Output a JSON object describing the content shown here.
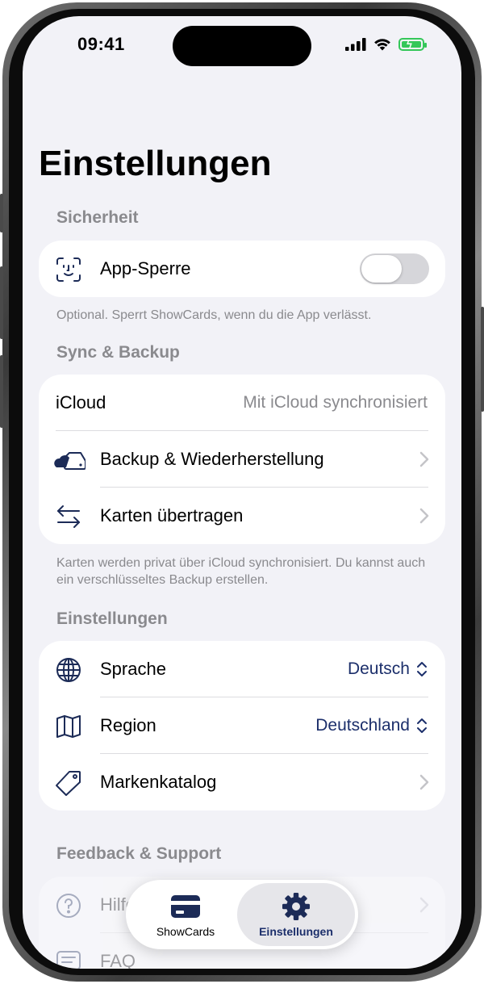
{
  "status_bar": {
    "time": "09:41"
  },
  "page": {
    "title": "Einstellungen"
  },
  "sections": {
    "security": {
      "header": "Sicherheit",
      "app_lock_label": "App-Sperre",
      "app_lock_on": false,
      "footer": "Optional. Sperrt ShowCards, wenn du die App verlässt."
    },
    "sync": {
      "header": "Sync & Backup",
      "icloud_label": "iCloud",
      "icloud_value": "Mit iCloud synchronisiert",
      "backup_label": "Backup & Wiederherstellung",
      "transfer_label": "Karten übertragen",
      "footer": "Karten werden privat über iCloud synchronisiert. Du kannst auch ein verschlüsseltes Backup erstellen."
    },
    "settings": {
      "header": "Einstellungen",
      "language_label": "Sprache",
      "language_value": "Deutsch",
      "region_label": "Region",
      "region_value": "Deutschland",
      "catalog_label": "Markenkatalog"
    },
    "support": {
      "header": "Feedback & Support",
      "help_label": "Hilfe",
      "faq_label": "FAQ"
    }
  },
  "tabbar": {
    "tabs": [
      {
        "label": "ShowCards",
        "icon": "card-icon",
        "selected": false
      },
      {
        "label": "Einstellungen",
        "icon": "gear-icon",
        "selected": true
      }
    ]
  },
  "colors": {
    "accent": "#1c2f6b",
    "background": "#f2f2f7",
    "secondary_text": "#8a8a8e",
    "battery": "#34c759"
  }
}
